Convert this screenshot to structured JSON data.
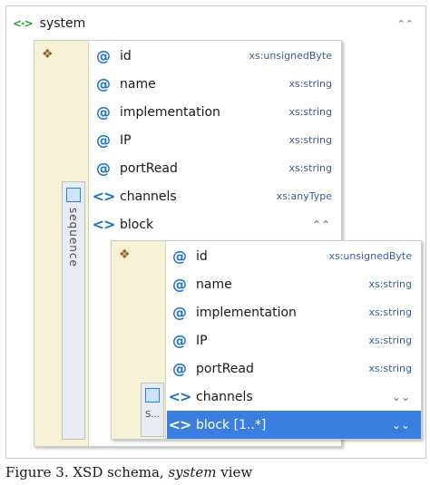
{
  "outer": {
    "icon": "<·>",
    "title": "system",
    "collapse": "⌃⌃"
  },
  "system_panel": {
    "seq_label": "sequence",
    "rows": [
      {
        "kind": "attr",
        "name": "id",
        "type": "xs:unsignedByte"
      },
      {
        "kind": "attr",
        "name": "name",
        "type": "xs:string"
      },
      {
        "kind": "attr",
        "name": "implementation",
        "type": "xs:string"
      },
      {
        "kind": "attr",
        "name": "IP",
        "type": "xs:string"
      },
      {
        "kind": "attr",
        "name": "portRead",
        "type": "xs:string"
      },
      {
        "kind": "elem",
        "name": "channels",
        "type": "xs:anyType"
      },
      {
        "kind": "elem",
        "name": "block",
        "type": ""
      }
    ]
  },
  "block_panel": {
    "seq_label": "S...",
    "rows": [
      {
        "kind": "attr",
        "name": "id",
        "type": "xs:unsignedByte"
      },
      {
        "kind": "attr",
        "name": "name",
        "type": "xs:string"
      },
      {
        "kind": "attr",
        "name": "implementation",
        "type": "xs:string"
      },
      {
        "kind": "attr",
        "name": "IP",
        "type": "xs:string"
      },
      {
        "kind": "attr",
        "name": "portRead",
        "type": "xs:string"
      },
      {
        "kind": "elem",
        "name": "channels",
        "type": ""
      },
      {
        "kind": "elem",
        "name": "block [1..*]",
        "type": ""
      }
    ]
  },
  "icons": {
    "attribute": "@",
    "element": "<>",
    "group": "compositor-icon",
    "sequence": "sequence-icon"
  },
  "caption": {
    "prefix": "Figure 3. XSD schema, ",
    "italic": "system",
    "suffix": " view"
  }
}
